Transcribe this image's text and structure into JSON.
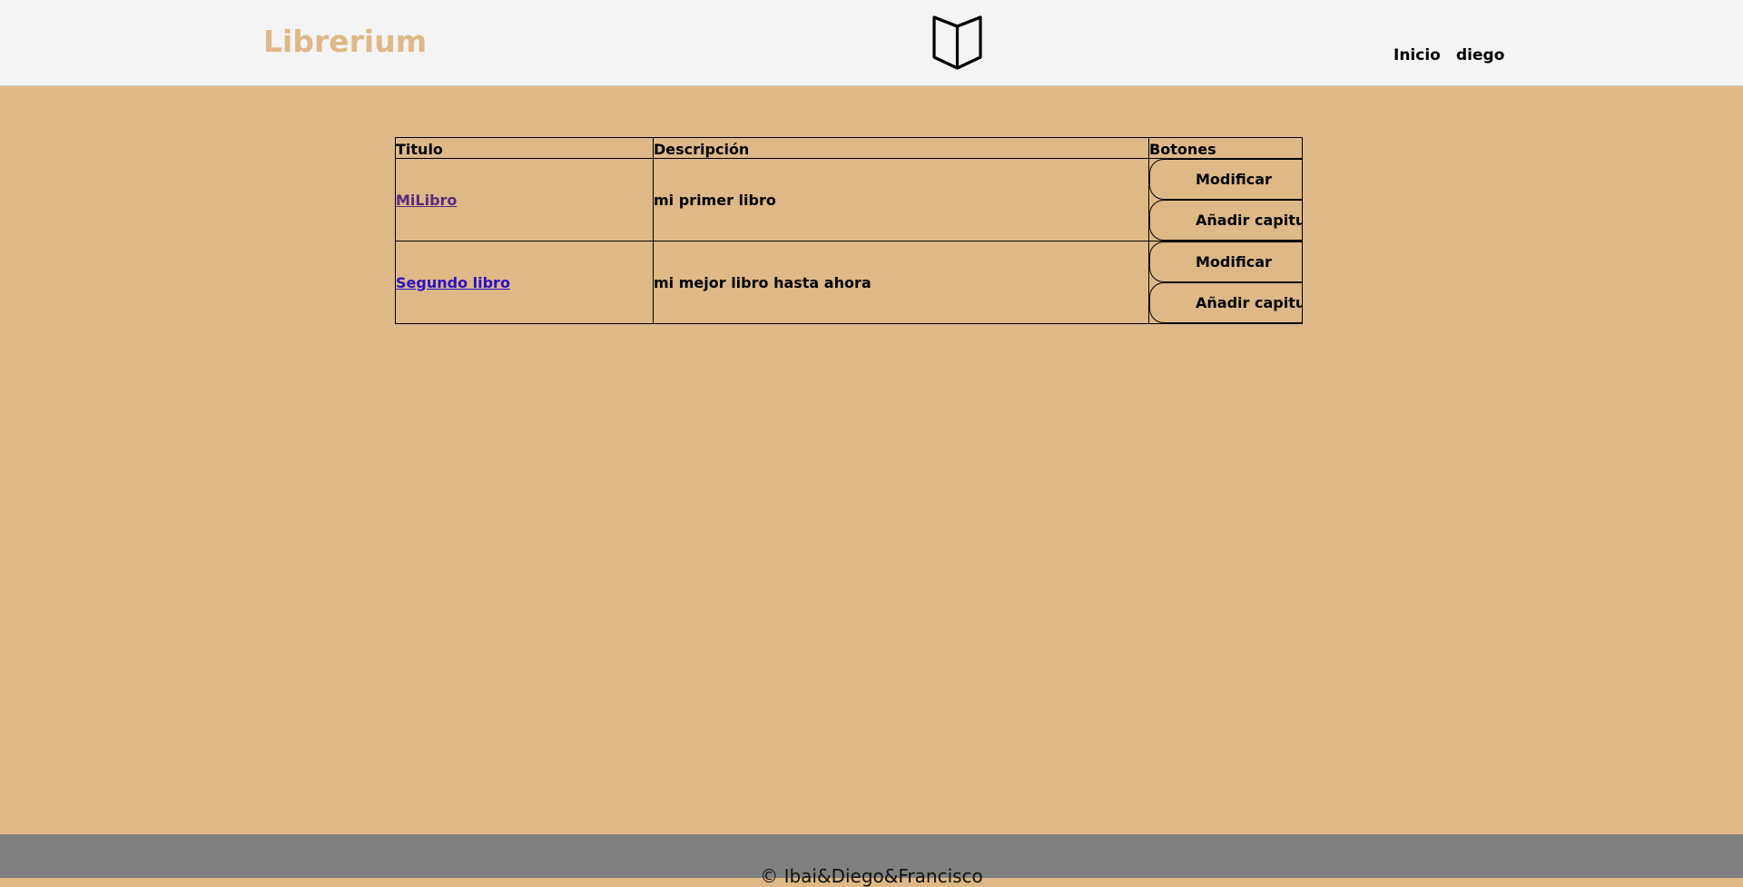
{
  "header": {
    "brand": "Librerium",
    "logo_icon": "open-book-icon",
    "nav": {
      "inicio": "Inicio",
      "user": "diego"
    }
  },
  "table": {
    "headers": {
      "titulo": "Titulo",
      "descripcion": "Descripción",
      "botones": "Botones"
    },
    "rows": [
      {
        "titulo": "MiLibro",
        "descripcion": "mi primer libro",
        "modificar": "Modificar",
        "anadir": "Añadir capitulo"
      },
      {
        "titulo": "Segundo libro",
        "descripcion": "mi mejor libro hasta ahora",
        "modificar": "Modificar",
        "anadir": "Añadir capitulo"
      }
    ]
  },
  "footer": {
    "copyright": "© Ibai&Diego&Francisco"
  },
  "colors": {
    "background": "#deb887",
    "header": "#f4f4f4",
    "footer": "#808080",
    "link": "#2a10c8",
    "link_visited": "#5a2a7a"
  }
}
